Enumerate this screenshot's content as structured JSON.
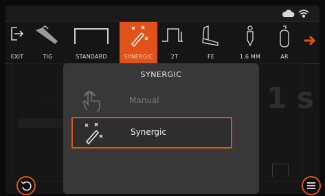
{
  "toolbar": {
    "items": [
      {
        "label": "EXIT",
        "icon": "exit-icon"
      },
      {
        "label": "TIG",
        "icon": "tig-torch-icon"
      },
      {
        "label": "STANDARD",
        "icon": "standard-waveform-icon"
      },
      {
        "label": "SYNERGIC",
        "icon": "synergic-wand-icon",
        "active": true
      },
      {
        "label": "2T",
        "icon": "2t-trigger-icon"
      },
      {
        "label": "FE",
        "icon": "fe-material-icon"
      },
      {
        "label": "1.6 MM",
        "icon": "electrode-diameter-icon"
      },
      {
        "label": "AR",
        "icon": "gas-bottle-icon"
      }
    ],
    "next": "next-arrow-icon"
  },
  "background": {
    "time_value": "1 s"
  },
  "modal": {
    "title": "SYNERGIC",
    "options": [
      {
        "label": "Manual",
        "icon": "manual-touch-icon",
        "enabled": false
      },
      {
        "label": "Synergic",
        "icon": "synergic-wand-icon",
        "selected": true
      }
    ]
  },
  "colors": {
    "accent": "#e0521a",
    "modal_bg": "#383838",
    "screen_bg": "#141414"
  }
}
